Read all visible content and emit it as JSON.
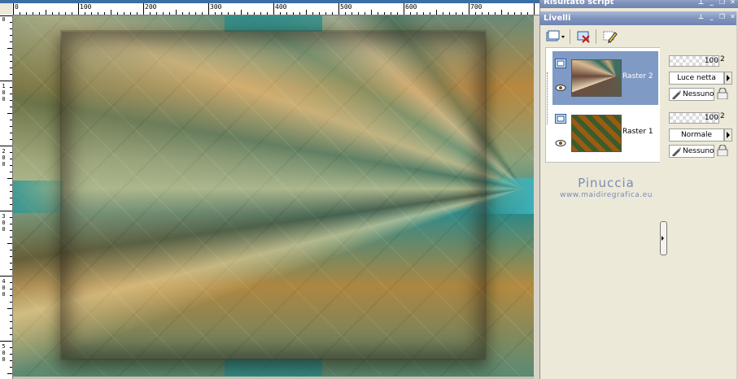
{
  "rulers": {
    "horizontal_labels": [
      "0",
      "100",
      "200",
      "300",
      "400",
      "500",
      "600",
      "700"
    ],
    "vertical_labels": [
      "0",
      "1\n0\n0",
      "2\n0\n0",
      "3\n0\n0",
      "4\n0\n0",
      "5\n0\n0"
    ]
  },
  "panels": {
    "top_title": "Risultato script",
    "layers_title": "Livelli"
  },
  "layers": [
    {
      "name": "Raster 2",
      "opacity": "100",
      "blend": "Luce netta",
      "mask": "Nessuno",
      "selected": true
    },
    {
      "name": "Raster 1",
      "opacity": "100",
      "blend": "Normale",
      "mask": "Nessuno",
      "selected": false
    }
  ],
  "watermark": {
    "name": "Pinuccia",
    "site": "www.maidiregrafica.eu"
  },
  "opacity_suffix": "2",
  "icons": {
    "pin": "pin-icon",
    "minimize": "minimize-icon",
    "restore": "restore-icon",
    "close": "close-icon"
  },
  "colors": {
    "titlebar": "#7f93bd",
    "selected_row": "#7f9ac4",
    "ruler_strip": "#3a6ea5"
  }
}
